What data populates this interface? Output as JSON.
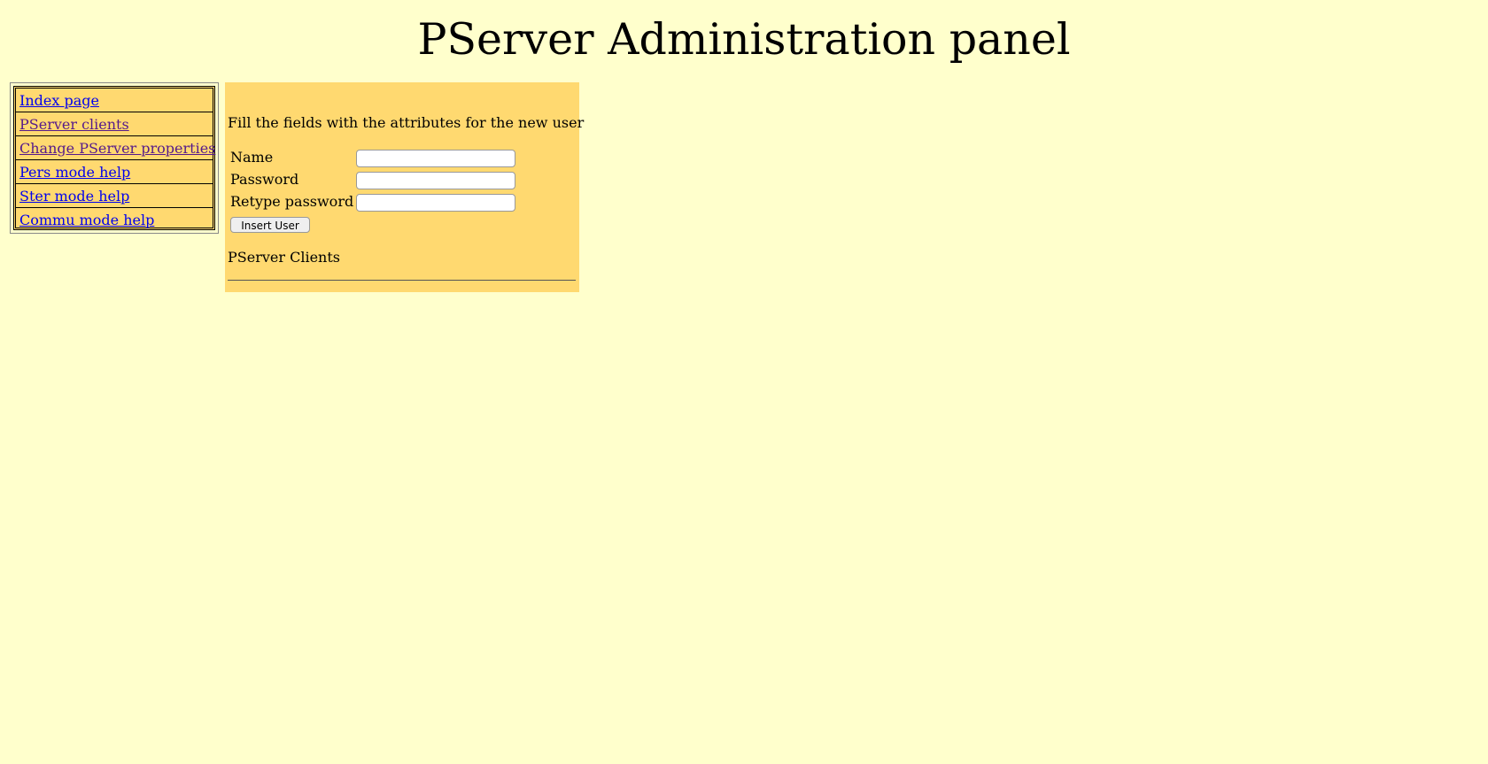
{
  "page": {
    "title": "PServer Administration panel"
  },
  "nav": {
    "items": [
      {
        "label": "Index page",
        "visited": false
      },
      {
        "label": "PServer clients",
        "visited": true
      },
      {
        "label": "Change PServer properties",
        "visited": true
      },
      {
        "label": "Pers mode help",
        "visited": false
      },
      {
        "label": "Ster mode help",
        "visited": false
      },
      {
        "label": "Commu mode help",
        "visited": false
      }
    ]
  },
  "form": {
    "intro": "Fill the fields with the attributes for the new user",
    "name_label": "Name",
    "name_value": "",
    "password_label": "Password",
    "password_value": "",
    "retype_label": "Retype password",
    "retype_value": "",
    "submit_label": "Insert User"
  },
  "clients": {
    "heading": "PServer Clients"
  },
  "colors": {
    "page_background": "#ffffcc",
    "panel_background": "#ffd970",
    "link": "#0000ee",
    "visited_link": "#551a8b"
  }
}
